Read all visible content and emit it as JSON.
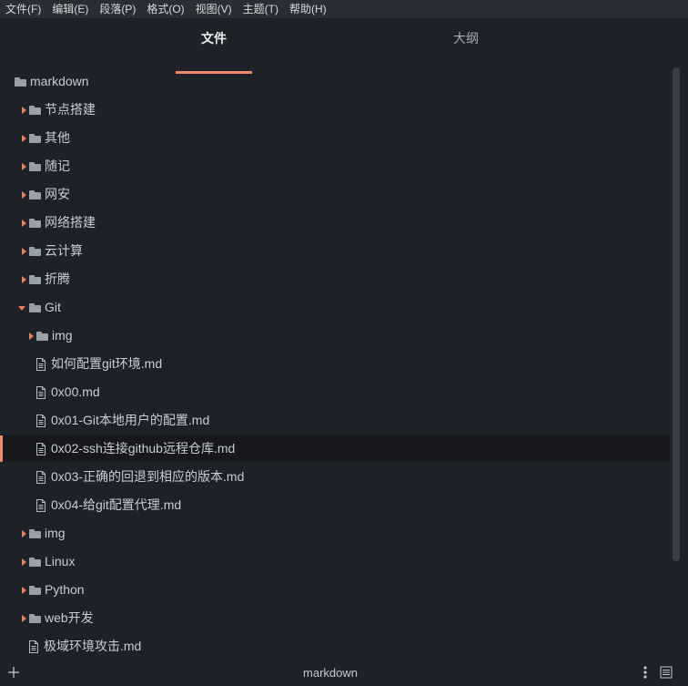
{
  "menu": {
    "items": [
      "文件(F)",
      "编辑(E)",
      "段落(P)",
      "格式(O)",
      "视图(V)",
      "主题(T)",
      "帮助(H)"
    ]
  },
  "tabs": {
    "files": "文件",
    "outline": "大纲"
  },
  "tree": {
    "root": "markdown",
    "items": [
      {
        "label": "节点搭建",
        "type": "folder",
        "expanded": false
      },
      {
        "label": "其他",
        "type": "folder",
        "expanded": false
      },
      {
        "label": "随记",
        "type": "folder",
        "expanded": false
      },
      {
        "label": "网安",
        "type": "folder",
        "expanded": false
      },
      {
        "label": "网络搭建",
        "type": "folder",
        "expanded": false
      },
      {
        "label": "云计算",
        "type": "folder",
        "expanded": false
      },
      {
        "label": "折腾",
        "type": "folder",
        "expanded": false
      },
      {
        "label": "Git",
        "type": "folder",
        "expanded": true
      },
      {
        "label": "img",
        "type": "folder",
        "expanded": false
      },
      {
        "label": "如何配置git环境.md",
        "type": "file"
      },
      {
        "label": "0x00.md",
        "type": "file"
      },
      {
        "label": "0x01-Git本地用户的配置.md",
        "type": "file"
      },
      {
        "label": "0x02-ssh连接github远程仓库.md",
        "type": "file",
        "active": true
      },
      {
        "label": "0x03-正确的回退到相应的版本.md",
        "type": "file"
      },
      {
        "label": "0x04-给git配置代理.md",
        "type": "file"
      },
      {
        "label": "img",
        "type": "folder",
        "expanded": false
      },
      {
        "label": "Linux",
        "type": "folder",
        "expanded": false
      },
      {
        "label": "Python",
        "type": "folder",
        "expanded": false
      },
      {
        "label": "web开发",
        "type": "folder",
        "expanded": false
      },
      {
        "label": "极域环境攻击.md",
        "type": "file"
      }
    ]
  },
  "footer": {
    "title": "markdown"
  },
  "colors": {
    "accent": "#f08a6b",
    "background": "#1e2127",
    "menubar": "#2a2d33",
    "active_row": "#16181c"
  },
  "icons": {
    "folder": "folder-icon",
    "file": "file-icon",
    "collapsed": "caret-right-icon",
    "expanded": "caret-down-icon",
    "add": "plus-icon",
    "more": "more-vertical-icon",
    "list": "list-icon"
  }
}
